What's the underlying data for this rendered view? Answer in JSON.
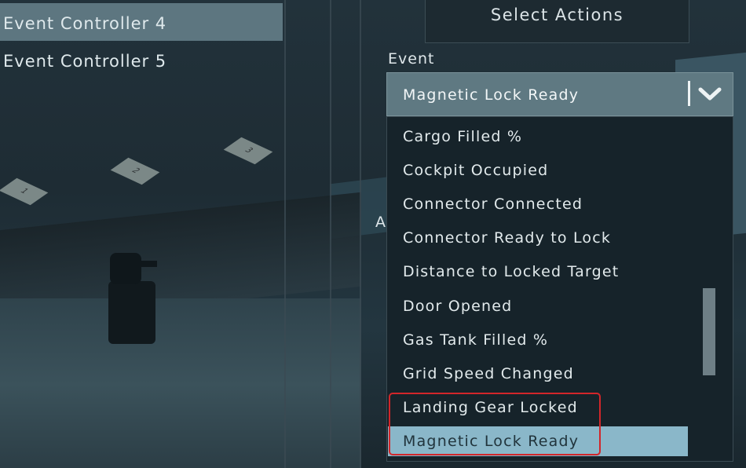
{
  "left_list": {
    "items": [
      {
        "label": "Event Controller 4",
        "selected": true
      },
      {
        "label": "Event Controller 5",
        "selected": false
      }
    ]
  },
  "panel": {
    "select_actions_label": "Select Actions",
    "event_label": "Event",
    "partial_label": "A"
  },
  "event_dropdown": {
    "selected_value": "Magnetic Lock Ready",
    "chevron_icon": "chevron-down-icon",
    "options": [
      {
        "label": "Cargo Filled %"
      },
      {
        "label": "Cockpit Occupied"
      },
      {
        "label": "Connector Connected"
      },
      {
        "label": "Connector Ready to Lock"
      },
      {
        "label": "Distance to Locked Target"
      },
      {
        "label": "Door Opened"
      },
      {
        "label": "Gas Tank Filled %"
      },
      {
        "label": "Grid Speed Changed"
      },
      {
        "label": "Landing Gear Locked"
      },
      {
        "label": "Magnetic Lock Ready",
        "selected": true
      }
    ]
  },
  "scene": {
    "tags": [
      "1",
      "2",
      "3"
    ]
  },
  "colors": {
    "selected_option": "#8ab7c9",
    "dropdown_bg": "#5f7982",
    "highlight_border": "#d2262a"
  }
}
